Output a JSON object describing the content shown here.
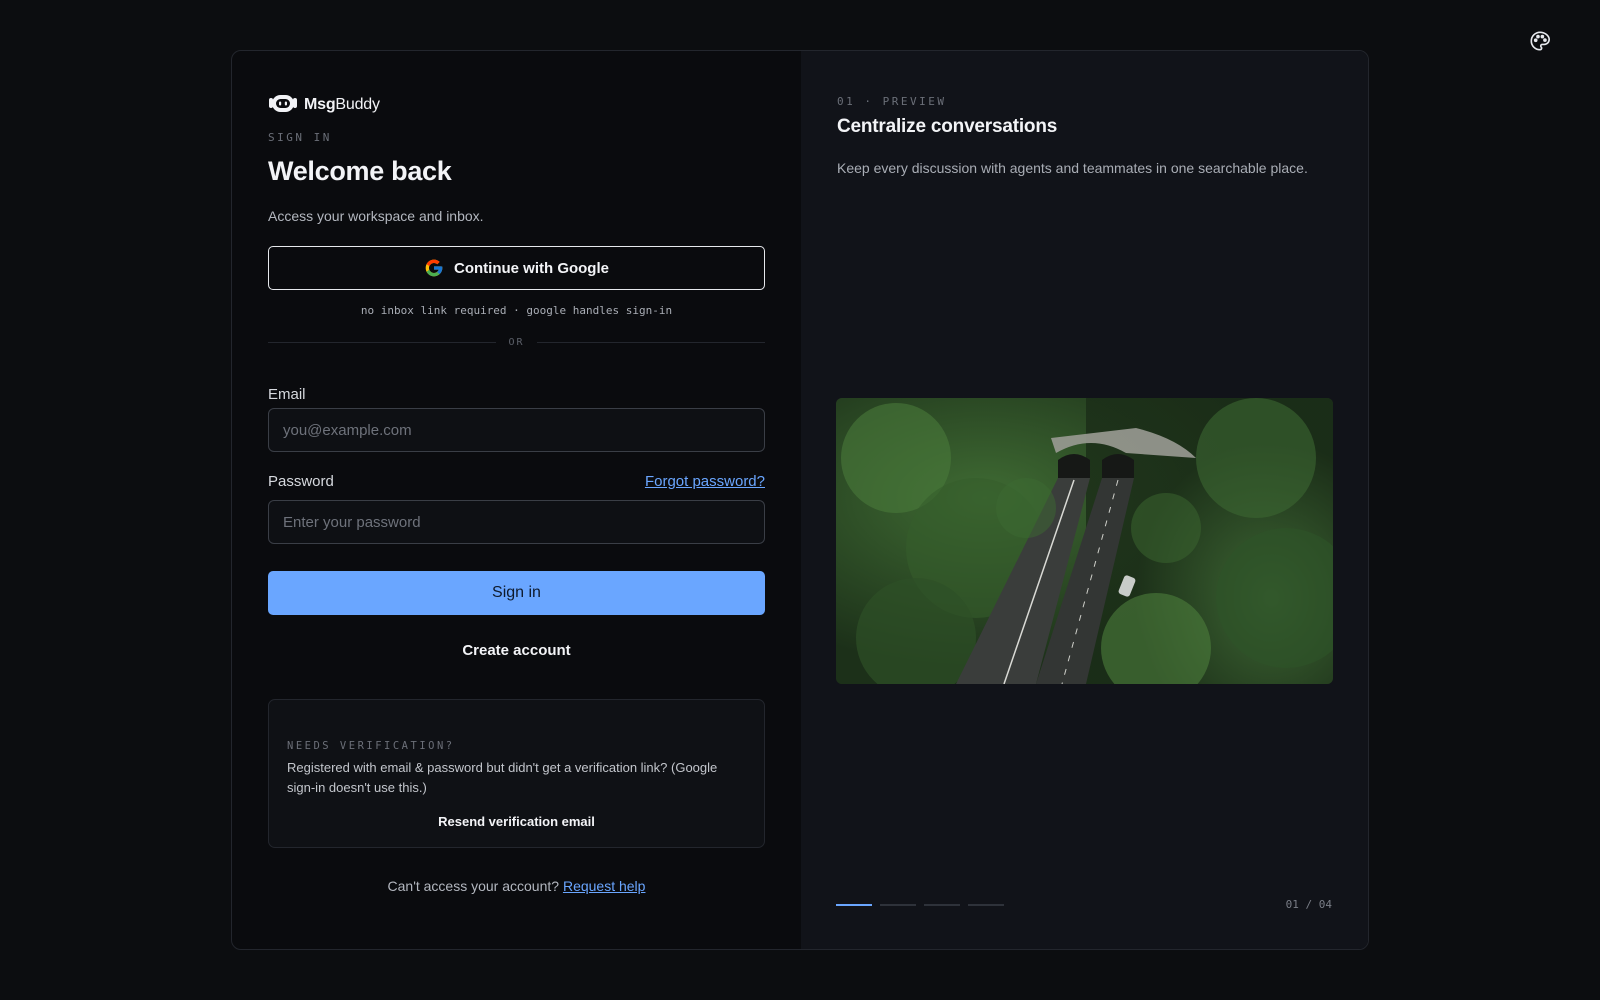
{
  "brand": {
    "name_bold": "Msg",
    "name_regular": "Buddy"
  },
  "signin": {
    "eyebrow": "SIGN IN",
    "title": "Welcome back",
    "subtitle": "Access your workspace and inbox.",
    "google_label": "Continue with Google",
    "google_hint": "no inbox link required · google handles sign-in",
    "divider": "OR",
    "email_label": "Email",
    "email_placeholder": "you@example.com",
    "password_label": "Password",
    "forgot_label": "Forgot password?",
    "password_placeholder": "Enter your password",
    "submit_label": "Sign in",
    "create_label": "Create account"
  },
  "verification": {
    "eyebrow": "NEEDS VERIFICATION?",
    "text": "Registered with email & password but didn't get a verification link? (Google sign-in doesn't use this.)",
    "resend_label": "Resend verification email"
  },
  "help": {
    "text": "Can't access your account?",
    "link": "Request help"
  },
  "preview": {
    "eyebrow": "01 · PREVIEW",
    "title": "Centralize conversations",
    "description": "Keep every discussion with agents and teammates in one searchable place.",
    "counter": "01 / 04",
    "slide_count": 4,
    "active_slide": 1
  },
  "colors": {
    "accent": "#6aa6ff",
    "background": "#0c0d10",
    "panel": "#111319"
  },
  "icons": {
    "theme": "palette-icon",
    "logo": "robot-logo-icon",
    "google": "google-g-icon"
  }
}
